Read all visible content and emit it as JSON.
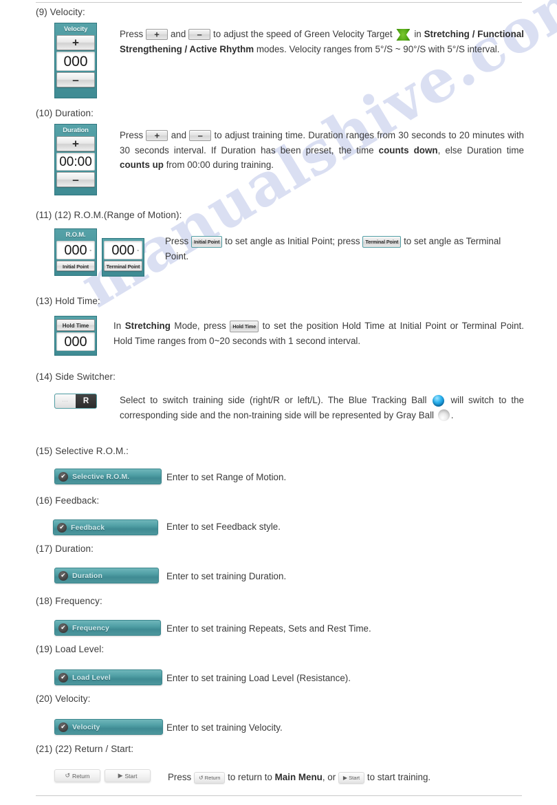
{
  "document": {
    "colors": {
      "teal": "#4b979e",
      "teal_dark": "#3f8b93",
      "green_target": "#55a916",
      "blue_ball": "#0a7fc4",
      "text": "#3a3a3a"
    },
    "watermark": "manualshive.com"
  },
  "sections": [
    {
      "id": "velocity",
      "number": "(9)",
      "title": "(9)  Velocity:",
      "widget": {
        "type": "stepper",
        "caption": "Velocity",
        "plus": "+",
        "minus": "–",
        "value": "000"
      },
      "paragraph_html": "Press <span class='chip chip-pm'><span class='g'>+</span></span> and <span class='chip chip-pm'><span class='g'>–</span></span> to adjust the speed of Green Velocity Target <span class='green-target'></span> in <b>Stretching / Functional Strengthening / Active Rhythm</b> modes. Velocity ranges from 5°/S ~ 90°/S with 5°/S interval.",
      "paragraph_text": "Press + and – to adjust the speed of Green Velocity Target in Stretching / Functional Strengthening / Active Rhythm modes. Velocity ranges from 5°/S ~ 90°/S with 5°/S interval."
    },
    {
      "id": "duration-stepper",
      "number": "(10)",
      "title": "(10)  Duration:",
      "widget": {
        "type": "stepper",
        "caption": "Duration",
        "plus": "+",
        "minus": "–",
        "value": "00:00"
      },
      "paragraph_html": "Press <span class='chip chip-pm'><span class='g'>+</span></span> and <span class='chip chip-pm'><span class='g'>–</span></span> to adjust training time. Duration ranges from 30 seconds to 20 minutes with 30 seconds interval. If Duration has been preset, the time <b>counts down</b>, else Duration time <b>counts up</b> from 00:00 during training.",
      "paragraph_text": "Press + and – to adjust training time. Duration ranges from 30 seconds to 20 minutes with 30 seconds interval. If Duration has been preset, the time counts down, else Duration time counts up from 00:00 during training."
    },
    {
      "id": "rom",
      "number": "(11) (12)",
      "title": "(11) (12)  R.O.M.(Range of Motion):",
      "widget": {
        "type": "rom",
        "caption": "R.O.M.",
        "initial_value": "000",
        "terminal_value": "000",
        "degree": "°",
        "initial_label": "Initial Point",
        "terminal_label": "Terminal Point"
      },
      "paragraph_html": "Press <span class='chip chip-lbl teal-edge'>Initial Point</span> to set angle as Initial Point; press <span class='chip chip-lbl teal-edge'>Terminal Point</span> to set angle as Terminal Point.",
      "paragraph_text": "Press Initial Point to set angle as Initial Point; press Terminal Point to set angle as Terminal Point."
    },
    {
      "id": "hold-time",
      "number": "(13)",
      "title": "(13)  Hold Time:",
      "widget": {
        "type": "holdtime",
        "button_label": "Hold Time",
        "value": "000"
      },
      "paragraph_html": "In <b>Stretching</b> Mode, press <span class='chip chip-lbl'>Hold Time</span> to set the position Hold Time at Initial Point or Terminal Point. Hold Time ranges from 0~20 seconds with 1 second interval.",
      "paragraph_text": "In Stretching Mode, press Hold Time to set the position Hold Time at Initial Point or Terminal Point. Hold Time ranges from 0~20 seconds with 1 second interval."
    },
    {
      "id": "side-switcher",
      "number": "(14)",
      "title": "(14)  Side Switcher:",
      "widget": {
        "type": "side-switch",
        "left_label": "∙∙∙",
        "right_label": "R"
      },
      "paragraph_html": "Select to switch training side (right/R or left/L). The Blue Tracking Ball <span class='ball blue'></span> will switch to the corresponding side and the non-training side will be represented by Gray Ball <span class='ball gray'></span>.",
      "paragraph_text": "Select to switch training side (right/R or left/L). The Blue Tracking Ball will switch to the corresponding side and the non-training side will be represented by Gray Ball ."
    },
    {
      "id": "selective-rom",
      "number": "(15)",
      "title": "(15)  Selective R.O.M.:",
      "widget": {
        "type": "menu-bar",
        "label": "Selective R.O.M.",
        "check": "✔",
        "width": 156
      },
      "paragraph_html": "Enter to set Range of Motion.",
      "paragraph_text": "Enter to set Range of Motion."
    },
    {
      "id": "feedback",
      "number": "(16)",
      "title": "(16)  Feedback:",
      "widget": {
        "type": "menu-bar",
        "label": "Feedback",
        "check": "✔",
        "width": 153
      },
      "paragraph_html": "Enter to set Feedback style.",
      "paragraph_text": "Enter to set Feedback style."
    },
    {
      "id": "duration-menu",
      "number": "(17)",
      "title": "(17)  Duration:",
      "widget": {
        "type": "menu-bar",
        "label": "Duration",
        "check": "✔",
        "width": 152
      },
      "paragraph_html": "Enter to set training Duration.",
      "paragraph_text": "Enter to set training Duration."
    },
    {
      "id": "frequency",
      "number": "(18)",
      "title": "(18)  Frequency:",
      "widget": {
        "type": "menu-bar",
        "label": "Frequency",
        "check": "✔",
        "width": 155
      },
      "paragraph_html": "Enter to set training Repeats, Sets and Rest Time.",
      "paragraph_text": "Enter to set training Repeats, Sets and Rest Time."
    },
    {
      "id": "load-level",
      "number": "(19)",
      "title": "(19)  Load Level:",
      "widget": {
        "type": "menu-bar",
        "label": "Load Level",
        "check": "✔",
        "width": 157
      },
      "paragraph_html": "Enter to set training Load Level (Resistance).",
      "paragraph_text": "Enter to set training Load Level (Resistance)."
    },
    {
      "id": "velocity-menu",
      "number": "(20)",
      "title": "(20)  Velocity:",
      "widget": {
        "type": "menu-bar",
        "label": "Velocity",
        "check": "✔",
        "width": 158
      },
      "paragraph_html": "Enter to set training Velocity.",
      "paragraph_text": "Enter to set training Velocity."
    },
    {
      "id": "return-start",
      "number": "(21) (22)",
      "title": "(21) (22)  Return / Start:",
      "widget": {
        "type": "pills",
        "return_label": "Return",
        "return_icon": "↺",
        "start_label": "Start",
        "start_icon": "▶"
      },
      "paragraph_html": "Press <span class='chip-gray'><span class='ic'>↺</span>Return</span> to return to <b>Main Menu</b>, or <span class='chip-gray'><span class='ic'>▶</span>Start</span> to start training.",
      "paragraph_text": "Press Return to return to Main Menu, or Start to start training."
    }
  ]
}
